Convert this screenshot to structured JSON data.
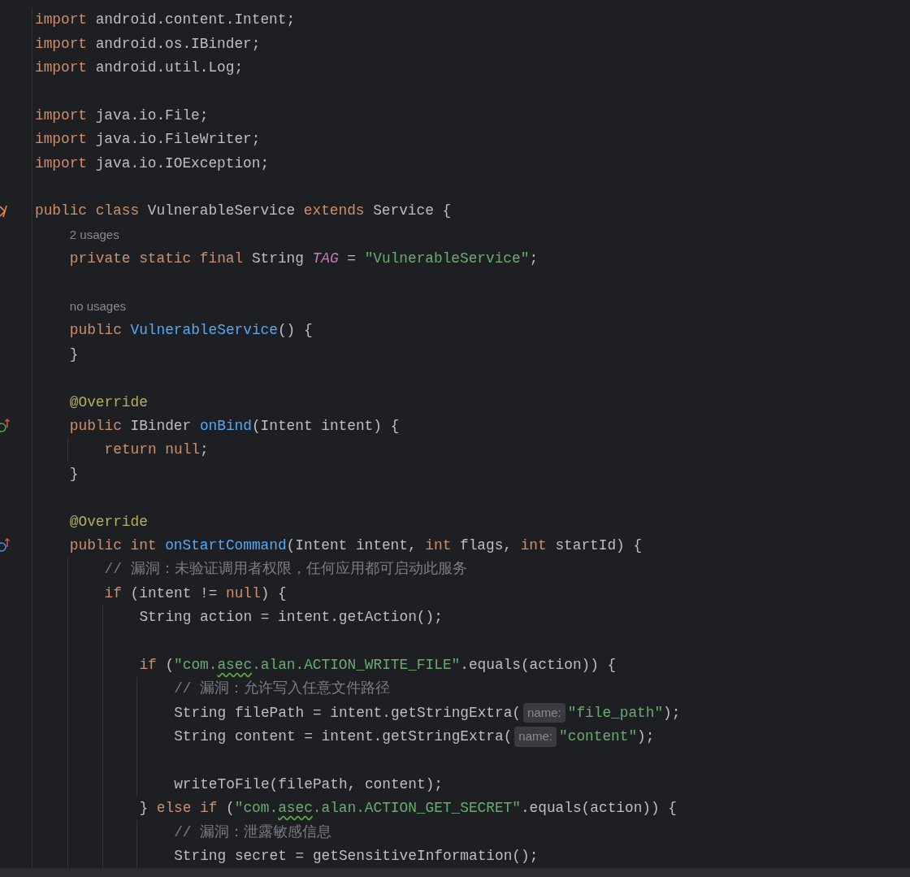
{
  "editor": {
    "lines": [
      {
        "kind": "code",
        "tokens": [
          {
            "kind": "kw",
            "text": "import "
          },
          {
            "kind": "plain",
            "text": "android.content.Intent;"
          }
        ]
      },
      {
        "kind": "code",
        "tokens": [
          {
            "kind": "kw",
            "text": "import "
          },
          {
            "kind": "plain",
            "text": "android.os.IBinder;"
          }
        ]
      },
      {
        "kind": "code",
        "tokens": [
          {
            "kind": "kw",
            "text": "import "
          },
          {
            "kind": "plain",
            "text": "android.util.Log;"
          }
        ]
      },
      {
        "kind": "blank"
      },
      {
        "kind": "code",
        "tokens": [
          {
            "kind": "kw",
            "text": "import "
          },
          {
            "kind": "plain",
            "text": "java.io.File;"
          }
        ]
      },
      {
        "kind": "code",
        "tokens": [
          {
            "kind": "kw",
            "text": "import "
          },
          {
            "kind": "plain",
            "text": "java.io.FileWriter;"
          }
        ]
      },
      {
        "kind": "code",
        "tokens": [
          {
            "kind": "kw",
            "text": "import "
          },
          {
            "kind": "plain",
            "text": "java.io.IOException;"
          }
        ]
      },
      {
        "kind": "blank"
      },
      {
        "kind": "code",
        "gutter": {
          "kind": "component"
        },
        "tokens": [
          {
            "kind": "kw",
            "text": "public class "
          },
          {
            "kind": "plain",
            "text": "VulnerableService "
          },
          {
            "kind": "kw",
            "text": "extends "
          },
          {
            "kind": "plain",
            "text": "Service {"
          }
        ],
        "children": [
          {
            "kind": "usages",
            "text": "2 usages"
          },
          {
            "kind": "code",
            "tokens": [
              {
                "kind": "kw",
                "text": "private static final "
              },
              {
                "kind": "plain",
                "text": "String "
              },
              {
                "kind": "static",
                "text": "TAG"
              },
              {
                "kind": "plain",
                "text": " = "
              },
              {
                "kind": "str",
                "text": "\"VulnerableService\""
              },
              {
                "kind": "plain",
                "text": ";"
              }
            ]
          },
          {
            "kind": "blank"
          },
          {
            "kind": "usages",
            "text": "no usages"
          },
          {
            "kind": "code",
            "tokens": [
              {
                "kind": "kw",
                "text": "public "
              },
              {
                "kind": "fn",
                "text": "VulnerableService"
              },
              {
                "kind": "plain",
                "text": "() {"
              }
            ]
          },
          {
            "kind": "code",
            "tokens": [
              {
                "kind": "plain",
                "text": "}"
              }
            ]
          },
          {
            "kind": "blank"
          },
          {
            "kind": "code",
            "tokens": [
              {
                "kind": "ann",
                "text": "@Override"
              }
            ]
          },
          {
            "kind": "code",
            "gutter": {
              "kind": "implements"
            },
            "tokens": [
              {
                "kind": "kw",
                "text": "public "
              },
              {
                "kind": "plain",
                "text": "IBinder "
              },
              {
                "kind": "fn",
                "text": "onBind"
              },
              {
                "kind": "plain",
                "text": "(Intent intent) {"
              }
            ],
            "children": [
              {
                "kind": "code",
                "tokens": [
                  {
                    "kind": "kw",
                    "text": "return null"
                  },
                  {
                    "kind": "plain",
                    "text": ";"
                  }
                ]
              }
            ]
          },
          {
            "kind": "code",
            "tokens": [
              {
                "kind": "plain",
                "text": "}"
              }
            ]
          },
          {
            "kind": "blank"
          },
          {
            "kind": "code",
            "tokens": [
              {
                "kind": "ann",
                "text": "@Override"
              }
            ]
          },
          {
            "kind": "code",
            "gutter": {
              "kind": "overrides"
            },
            "tokens": [
              {
                "kind": "kw",
                "text": "public int "
              },
              {
                "kind": "fn",
                "text": "onStartCommand"
              },
              {
                "kind": "plain",
                "text": "(Intent intent, "
              },
              {
                "kind": "kw",
                "text": "int "
              },
              {
                "kind": "plain",
                "text": "flags, "
              },
              {
                "kind": "kw",
                "text": "int "
              },
              {
                "kind": "plain",
                "text": "startId) {"
              }
            ],
            "children": [
              {
                "kind": "code",
                "tokens": [
                  {
                    "kind": "cmt",
                    "text": "// 漏洞：未验证调用者权限，任何应用都可启动此服务"
                  }
                ]
              },
              {
                "kind": "code",
                "tokens": [
                  {
                    "kind": "kw",
                    "text": "if "
                  },
                  {
                    "kind": "plain",
                    "text": "(intent != "
                  },
                  {
                    "kind": "kw",
                    "text": "null"
                  },
                  {
                    "kind": "plain",
                    "text": ") {"
                  }
                ],
                "children": [
                  {
                    "kind": "code",
                    "tokens": [
                      {
                        "kind": "plain",
                        "text": "String action = intent.getAction();"
                      }
                    ]
                  },
                  {
                    "kind": "blank"
                  },
                  {
                    "kind": "code",
                    "tokens": [
                      {
                        "kind": "kw",
                        "text": "if "
                      },
                      {
                        "kind": "plain",
                        "text": "("
                      },
                      {
                        "kind": "str",
                        "text": "\"com."
                      },
                      {
                        "kind": "squiggle",
                        "text": "asec"
                      },
                      {
                        "kind": "str",
                        "text": ".alan.ACTION_WRITE_FILE\""
                      },
                      {
                        "kind": "plain",
                        "text": ".equals(action)) {"
                      }
                    ],
                    "children": [
                      {
                        "kind": "code",
                        "tokens": [
                          {
                            "kind": "cmt",
                            "text": "// 漏洞：允许写入任意文件路径"
                          }
                        ]
                      },
                      {
                        "kind": "code",
                        "tokens": [
                          {
                            "kind": "plain",
                            "text": "String filePath = intent.getStringExtra("
                          },
                          {
                            "kind": "hint",
                            "text": "name:"
                          },
                          {
                            "kind": "str",
                            "text": "\"file_path\""
                          },
                          {
                            "kind": "plain",
                            "text": ");"
                          }
                        ]
                      },
                      {
                        "kind": "code",
                        "tokens": [
                          {
                            "kind": "plain",
                            "text": "String content = intent.getStringExtra("
                          },
                          {
                            "kind": "hint",
                            "text": "name:"
                          },
                          {
                            "kind": "str",
                            "text": "\"content\""
                          },
                          {
                            "kind": "plain",
                            "text": ");"
                          }
                        ]
                      },
                      {
                        "kind": "blank"
                      },
                      {
                        "kind": "code",
                        "tokens": [
                          {
                            "kind": "plain",
                            "text": "writeToFile(filePath, content);"
                          }
                        ]
                      }
                    ]
                  },
                  {
                    "kind": "code",
                    "tokens": [
                      {
                        "kind": "plain",
                        "text": "} "
                      },
                      {
                        "kind": "kw",
                        "text": "else if "
                      },
                      {
                        "kind": "plain",
                        "text": "("
                      },
                      {
                        "kind": "str",
                        "text": "\"com."
                      },
                      {
                        "kind": "squiggle",
                        "text": "asec"
                      },
                      {
                        "kind": "str",
                        "text": ".alan.ACTION_GET_SECRET\""
                      },
                      {
                        "kind": "plain",
                        "text": ".equals(action)) {"
                      }
                    ],
                    "children": [
                      {
                        "kind": "code",
                        "tokens": [
                          {
                            "kind": "cmt",
                            "text": "// 漏洞：泄露敏感信息"
                          }
                        ]
                      },
                      {
                        "kind": "code",
                        "tokens": [
                          {
                            "kind": "plain",
                            "text": "String secret = getSensitiveInformation();"
                          }
                        ]
                      }
                    ]
                  }
                ]
              }
            ]
          }
        ]
      }
    ]
  }
}
